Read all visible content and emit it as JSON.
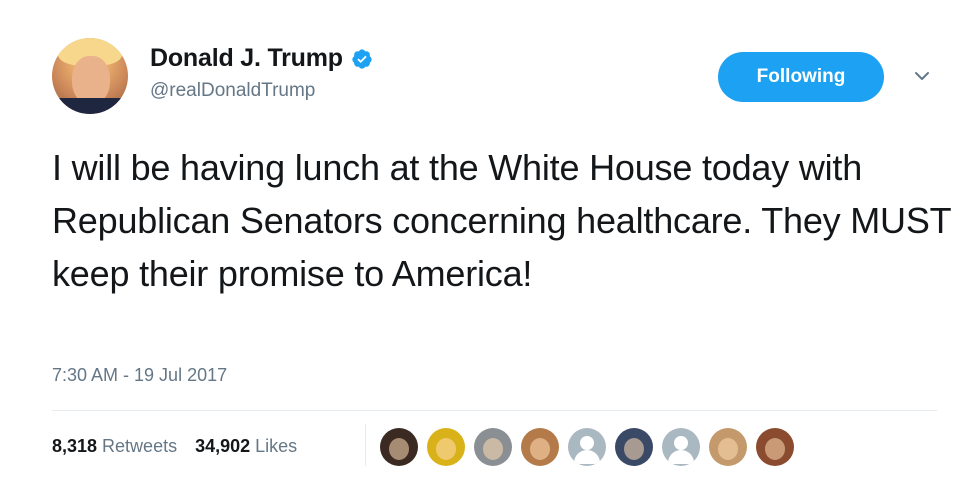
{
  "user": {
    "display_name": "Donald J. Trump",
    "handle": "@realDonaldTrump",
    "verified": true,
    "avatar_icon": "profile-photo"
  },
  "follow_button": {
    "label": "Following"
  },
  "menu_icon": "chevron-down-icon",
  "tweet": {
    "text": "I will be having lunch at the White House today with Republican Senators concerning healthcare. They MUST keep their promise to America!",
    "timestamp": "7:30 AM - 19 Jul 2017"
  },
  "stats": {
    "retweets_count": "8,318",
    "retweets_label": "Retweets",
    "likes_count": "34,902",
    "likes_label": "Likes"
  },
  "likers": [
    {
      "name": "liker-avatar-1",
      "color": "#3b2a22"
    },
    {
      "name": "liker-avatar-2",
      "color": "#d9b21a"
    },
    {
      "name": "liker-avatar-3",
      "color": "#8a8f93"
    },
    {
      "name": "liker-avatar-4",
      "color": "#b57a4a"
    },
    {
      "name": "liker-avatar-5",
      "color": "#aab8c2",
      "default": true
    },
    {
      "name": "liker-avatar-6",
      "color": "#3a4a66"
    },
    {
      "name": "liker-avatar-7",
      "color": "#aab8c2",
      "default": true
    },
    {
      "name": "liker-avatar-8",
      "color": "#c49a6c"
    },
    {
      "name": "liker-avatar-9",
      "color": "#8a4b2e"
    }
  ],
  "colors": {
    "accent": "#1da1f2",
    "text_primary": "#14171a",
    "text_secondary": "#657786",
    "divider": "#e6ecf0"
  }
}
